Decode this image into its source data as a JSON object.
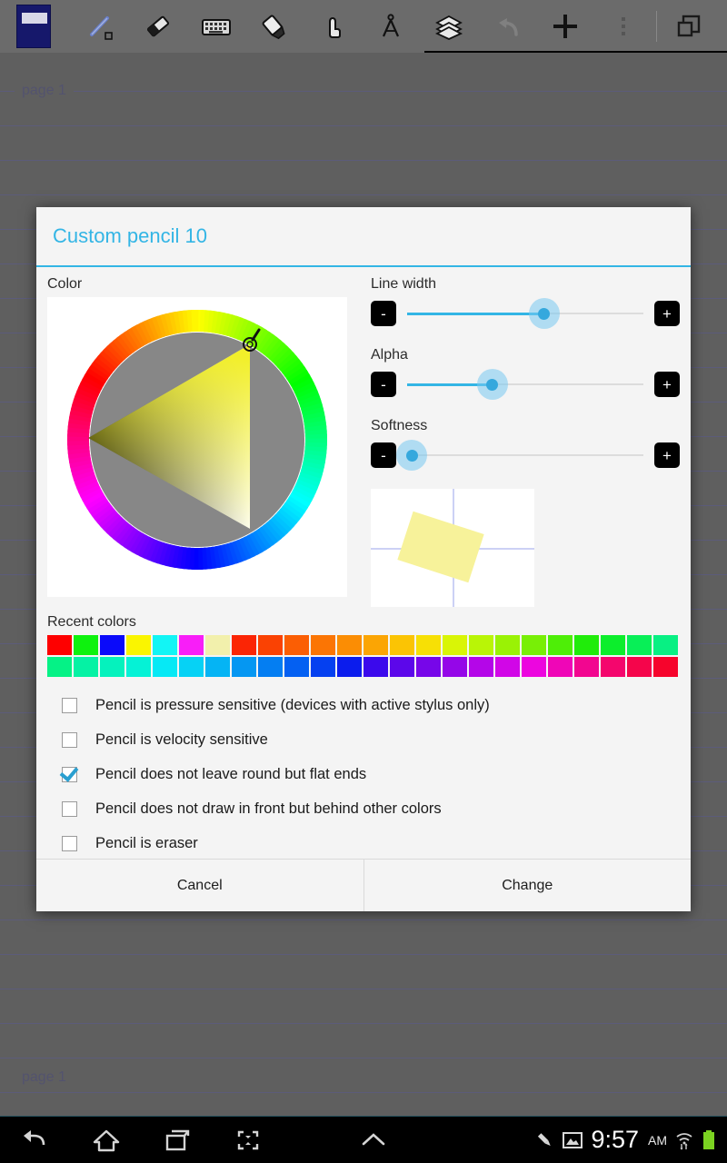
{
  "toolbar": {
    "app_logo_name": "app-logo",
    "tools": [
      {
        "name": "pencil-tool-icon",
        "label": "Pencil"
      },
      {
        "name": "eraser-tool-icon",
        "label": "Eraser"
      },
      {
        "name": "keyboard-tool-icon",
        "label": "Keyboard"
      },
      {
        "name": "marker-tool-icon",
        "label": "Marker"
      },
      {
        "name": "hand-tool-icon",
        "label": "Hand"
      },
      {
        "name": "compass-tool-icon",
        "label": "Compass"
      },
      {
        "name": "layers-tool-icon",
        "label": "Layers"
      },
      {
        "name": "undo-icon",
        "label": "Undo"
      },
      {
        "name": "add-icon",
        "label": "Add"
      },
      {
        "name": "overflow-menu-icon",
        "label": "More options"
      },
      {
        "name": "window-icon",
        "label": "Windows"
      }
    ]
  },
  "palette": {
    "columns": 10,
    "rows": 3,
    "cells": [
      {
        "name": "pen-black-thin",
        "color": "#151515",
        "width": 2,
        "kind": "stroke"
      },
      {
        "name": "pen-darkred-thin",
        "color": "#8b2020",
        "width": 2,
        "kind": "stroke"
      },
      {
        "name": "pen-green-thin",
        "color": "#2f7a36",
        "width": 2,
        "kind": "stroke"
      },
      {
        "name": "pen-blue-thin",
        "color": "#2a3b8f",
        "width": 2,
        "kind": "stroke"
      },
      {
        "name": "pen-red-thin",
        "color": "#9c2020",
        "width": 3,
        "kind": "stroke"
      },
      {
        "name": "pen-olive-thin",
        "color": "#9a8a12",
        "width": 3,
        "kind": "stroke"
      },
      {
        "name": "pen-red2-thin",
        "color": "#a02424",
        "width": 3,
        "kind": "stroke"
      },
      {
        "name": "pen-custom-selected",
        "color": "#8b8560",
        "width": 16,
        "kind": "stroke",
        "selected": true
      },
      {
        "name": "shape-line-tool",
        "color": "#8b8547",
        "kind": "line"
      },
      {
        "name": "shape-text-tool",
        "color": "#8b8547",
        "kind": "text"
      },
      {
        "name": "pen-black-medium",
        "color": "#111111",
        "width": 5,
        "kind": "stroke"
      },
      {
        "name": "pen-darkred-medium",
        "color": "#a01818",
        "width": 5,
        "kind": "stroke"
      },
      {
        "name": "pen-green-medium",
        "color": "#1f8b2a",
        "width": 5,
        "kind": "stroke"
      },
      {
        "name": "pen-navy-medium",
        "color": "#1c2a8f",
        "width": 5,
        "kind": "stroke"
      },
      {
        "name": "pen-green2-medium",
        "color": "#1f9638",
        "width": 5,
        "kind": "stroke"
      },
      {
        "name": "pen-teal-medium",
        "color": "#15a0a8",
        "width": 5,
        "kind": "stroke"
      },
      {
        "name": "pen-green3-medium",
        "color": "#169638",
        "width": 5,
        "kind": "stroke"
      },
      {
        "name": "pen-cyan-medium",
        "color": "#13a6b4",
        "width": 5,
        "kind": "stroke"
      },
      {
        "name": "shape-rect-outline-tool",
        "color": "#8b8547",
        "kind": "rect-outline"
      },
      {
        "name": "shape-circle-outline-tool",
        "color": "#8b8547",
        "kind": "circle-outline"
      },
      {
        "name": "pen-black-thick",
        "color": "#0a0a0a",
        "width": 9,
        "kind": "stroke"
      },
      {
        "name": "pen-red-thick",
        "color": "#a81212",
        "width": 9,
        "kind": "stroke"
      },
      {
        "name": "pen-green-thick",
        "color": "#12901e",
        "width": 9,
        "kind": "stroke"
      },
      {
        "name": "pen-navy-thick",
        "color": "#15207f",
        "width": 9,
        "kind": "stroke"
      },
      {
        "name": "pen-blue-thick",
        "color": "#1526a0",
        "width": 9,
        "kind": "stroke"
      },
      {
        "name": "pen-magenta-thick",
        "color": "#aa1aa8",
        "width": 9,
        "kind": "stroke"
      },
      {
        "name": "pen-brush-thick",
        "color": "#9a5050",
        "width": 20,
        "kind": "stroke"
      },
      {
        "name": "pen-violet-thick",
        "color": "#b01ab0",
        "width": 9,
        "kind": "stroke"
      },
      {
        "name": "shape-rect-filled-tool",
        "color": "#8b8547",
        "kind": "rect-filled"
      },
      {
        "name": "shape-circle-filled-tool",
        "color": "#8b8547",
        "kind": "circle-filled"
      }
    ]
  },
  "page": {
    "top_label": "page 1",
    "bottom_label": "page 1",
    "background": "#5f5f5f",
    "rule_color": "#5c5c7a",
    "rule_spacing": 38
  },
  "dialog": {
    "title": "Custom pencil 10",
    "accent_color": "#33b5e5",
    "color_section_label": "Color",
    "wheel": {
      "name": "color-wheel",
      "selected_hue_deg": 62,
      "selected_color": "#f7f29a"
    },
    "sliders": [
      {
        "name": "line-width-slider",
        "label": "Line width",
        "value_pct": 58,
        "minus": "-",
        "plus": "+"
      },
      {
        "name": "alpha-slider",
        "label": "Alpha",
        "value_pct": 36,
        "minus": "-",
        "plus": "+"
      },
      {
        "name": "softness-slider",
        "label": "Softness",
        "value_pct": 2,
        "minus": "-",
        "plus": "+"
      }
    ],
    "preview": {
      "name": "stroke-preview",
      "stroke_color": "#f7f29a",
      "guide_color": "#ccd1f5"
    },
    "recent_colors_label": "Recent colors",
    "recent_colors_row1": [
      "#fe0000",
      "#0ef20e",
      "#0a0afa",
      "#faf500",
      "#12f5f5",
      "#f81ef8",
      "#f2f0ac",
      "#fb2505",
      "#fa4203",
      "#fb5e04",
      "#fb7504",
      "#fb8d04",
      "#fba504",
      "#fbc404",
      "#f7e005",
      "#d9f506",
      "#b9f506",
      "#9af205",
      "#78ef06",
      "#4eee07",
      "#20ec0a",
      "#0cee2c",
      "#08ef57",
      "#08f083"
    ],
    "recent_colors_row2": [
      "#05f286",
      "#05f2a4",
      "#05f2bd",
      "#05f2d6",
      "#06e9f5",
      "#06d2f5",
      "#05b4f4",
      "#0597f2",
      "#047ef2",
      "#0460f2",
      "#0540f0",
      "#0b1ced",
      "#3b09ec",
      "#5c07ea",
      "#7706e9",
      "#9506e8",
      "#b406e8",
      "#d106e7",
      "#ec06df",
      "#ef06b7",
      "#f20690",
      "#f4066d",
      "#f5054b",
      "#f6042c"
    ],
    "checkboxes": [
      {
        "name": "checkbox-pressure-sensitive",
        "label": "Pencil is pressure sensitive (devices with active stylus only)",
        "checked": false
      },
      {
        "name": "checkbox-velocity-sensitive",
        "label": "Pencil is velocity sensitive",
        "checked": false
      },
      {
        "name": "checkbox-flat-ends",
        "label": "Pencil does not leave round but flat ends",
        "checked": true
      },
      {
        "name": "checkbox-draw-behind",
        "label": "Pencil does not draw in front but behind other colors",
        "checked": false
      },
      {
        "name": "checkbox-is-eraser",
        "label": "Pencil is eraser",
        "checked": false
      }
    ],
    "cancel_label": "Cancel",
    "confirm_label": "Change"
  },
  "navbar": {
    "buttons": [
      {
        "name": "nav-back-icon",
        "label": "Back"
      },
      {
        "name": "nav-home-icon",
        "label": "Home"
      },
      {
        "name": "nav-recents-icon",
        "label": "Recent apps"
      },
      {
        "name": "nav-screenshot-icon",
        "label": "Screenshot"
      },
      {
        "name": "nav-expand-icon",
        "label": "Expand"
      }
    ],
    "status": {
      "pencil_icon": "pencil-status-icon",
      "image_icon": "image-status-icon",
      "time": "9:57",
      "ampm": "AM",
      "wifi_icon": "wifi-icon",
      "battery_icon": "battery-icon",
      "battery_color": "#7bd321"
    }
  }
}
